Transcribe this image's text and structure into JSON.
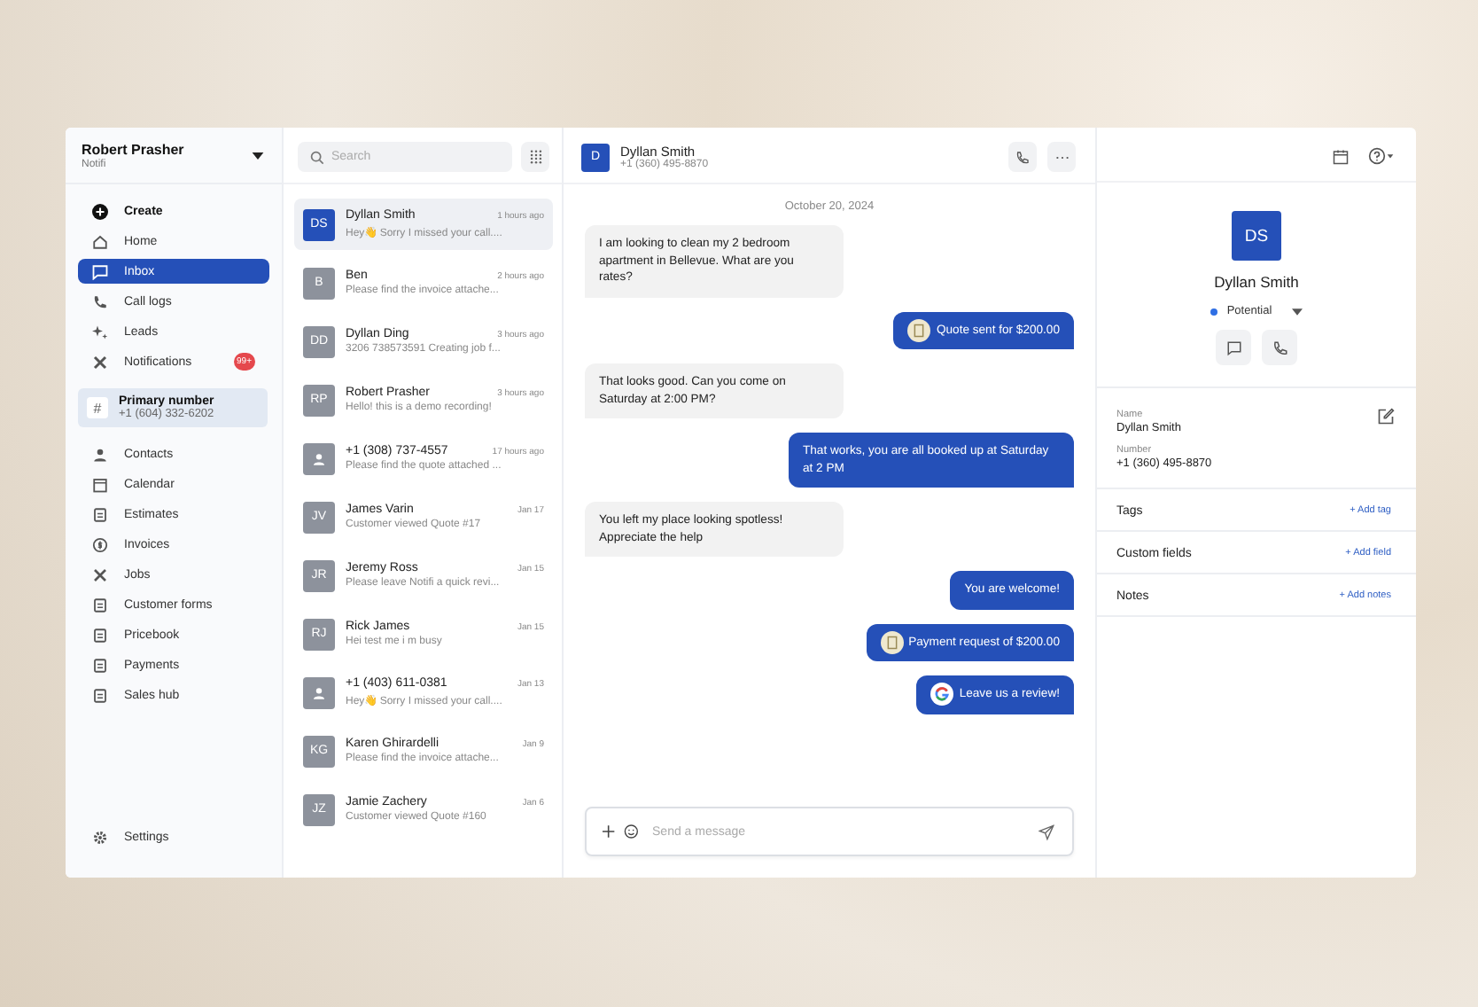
{
  "account": {
    "name": "Robert Prasher",
    "company": "Notifi"
  },
  "nav_top": [
    {
      "label": "Create",
      "selected": false
    },
    {
      "label": "Home",
      "selected": false
    },
    {
      "label": "Inbox",
      "selected": true
    },
    {
      "label": "Call logs",
      "selected": false
    },
    {
      "label": "Leads",
      "selected": false
    },
    {
      "label": "Notifications",
      "selected": false,
      "badge": "99+"
    }
  ],
  "primary_number": {
    "label": "Primary number",
    "number": "+1 (604) 332-6202",
    "glyph": "#"
  },
  "nav_bottom": [
    {
      "label": "Contacts",
      "selected": false
    },
    {
      "label": "Calendar",
      "selected": false
    },
    {
      "label": "Estimates",
      "selected": false
    },
    {
      "label": "Invoices",
      "selected": false
    },
    {
      "label": "Jobs",
      "selected": false
    },
    {
      "label": "Customer forms",
      "selected": false
    },
    {
      "label": "Pricebook",
      "selected": false
    },
    {
      "label": "Payments",
      "selected": false
    },
    {
      "label": "Sales hub",
      "selected": false
    }
  ],
  "settings": {
    "label": "Settings"
  },
  "search": {
    "placeholder": "Search"
  },
  "conversations": [
    {
      "kind": "initials",
      "initials": "DS",
      "name": "Dyllan Smith",
      "time": "1 hours ago",
      "preview": "Hey👋 Sorry I missed your call....",
      "selected": true
    },
    {
      "kind": "initials",
      "initials": "B",
      "name": "Ben",
      "time": "2 hours ago",
      "preview": "Please find the invoice attache...",
      "selected": false
    },
    {
      "kind": "initials",
      "initials": "DD",
      "name": "Dyllan Ding",
      "time": "3 hours ago",
      "preview": "3206 738573591 Creating job f...",
      "selected": false
    },
    {
      "kind": "initials",
      "initials": "RP",
      "name": "Robert Prasher",
      "time": "3 hours ago",
      "preview": "Hello! this is a demo recording!",
      "selected": false
    },
    {
      "kind": "person",
      "name": "+1 (308) 737-4557",
      "time": "17 hours ago",
      "preview": "Please find the quote attached ...",
      "selected": false
    },
    {
      "kind": "initials",
      "initials": "JV",
      "name": "James Varin",
      "time": "Jan 17",
      "preview": "Customer viewed Quote #17",
      "selected": false
    },
    {
      "kind": "initials",
      "initials": "JR",
      "name": "Jeremy Ross",
      "time": "Jan 15",
      "preview": "Please leave Notifi a quick revi...",
      "selected": false
    },
    {
      "kind": "initials",
      "initials": "RJ",
      "name": "Rick James",
      "time": "Jan 15",
      "preview": "Hei test me i m busy",
      "selected": false
    },
    {
      "kind": "person",
      "name": "+1 (403) 611-0381",
      "time": "Jan 13",
      "preview": "Hey👋 Sorry I missed your call....",
      "selected": false
    },
    {
      "kind": "initials",
      "initials": "KG",
      "name": "Karen Ghirardelli",
      "time": "Jan 9",
      "preview": "Please find the invoice attache...",
      "selected": false
    },
    {
      "kind": "initials",
      "initials": "JZ",
      "name": "Jamie Zachery",
      "time": "Jan 6",
      "preview": "Customer viewed Quote #160",
      "selected": false
    }
  ],
  "chat": {
    "initial": "D",
    "name": "Dyllan Smith",
    "phone": "+1 (360) 495-8870",
    "date": "October 20, 2024",
    "messages": [
      {
        "kind": "incoming",
        "text": "I am looking to clean my 2 bedroom apartment in Bellevue. What are you rates?"
      },
      {
        "kind": "quote",
        "text": "Quote sent for $200.00"
      },
      {
        "kind": "incoming",
        "text": "That looks good. Can you come on Saturday at 2:00 PM?"
      },
      {
        "kind": "outgoing",
        "text": "That works, you are all booked up at Saturday at 2 PM"
      },
      {
        "kind": "incoming",
        "text": "You left my place looking spotless! Appreciate the help"
      },
      {
        "kind": "outgoing",
        "text": "You are welcome!"
      },
      {
        "kind": "payment",
        "text": "Payment request of $200.00"
      },
      {
        "kind": "review",
        "text": "Leave us a review!"
      }
    ],
    "composer_placeholder": "Send a message"
  },
  "contact": {
    "initials": "DS",
    "name": "Dyllan Smith",
    "status": {
      "label": "Potential",
      "color": "#2f6fe4"
    },
    "fields": [
      {
        "label": "Name",
        "value": "Dyllan Smith"
      },
      {
        "label": "Number",
        "value": "+1 (360) 495-8870"
      }
    ],
    "sections": [
      {
        "title": "Tags",
        "action": "+ Add tag"
      },
      {
        "title": "Custom fields",
        "action": "+ Add field"
      },
      {
        "title": "Notes",
        "action": "+ Add notes"
      }
    ]
  }
}
